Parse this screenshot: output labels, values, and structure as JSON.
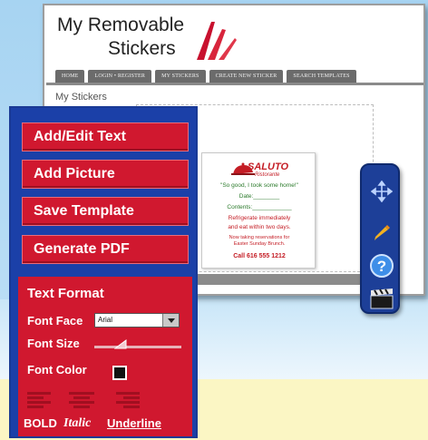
{
  "site": {
    "logo_line1": "My Removable",
    "logo_line2": "Stickers",
    "nav": [
      "HOME",
      "LOGIN • REGISTER",
      "MY STICKERS",
      "CREATE NEW STICKER",
      "SEARCH TEMPLATES"
    ],
    "page_heading": "My Stickers"
  },
  "sticker": {
    "brand": "SALUTO",
    "brand_sub": "Ristorante",
    "quote": "\"So good, I took some home!\"",
    "date_label": "Date:________",
    "contents_label": "Contents:____________",
    "refrigerate_line1": "Refrigerate immediately",
    "refrigerate_line2": "and eat within two days.",
    "reservation_line1": "Now taking reservations for",
    "reservation_line2": "Easter Sunday Brunch.",
    "phone": "Call 616 555 1212"
  },
  "tools": {
    "items": [
      "move-icon",
      "pencil-icon",
      "help-icon",
      "clapperboard-icon"
    ]
  },
  "panel": {
    "add_edit_text": "Add/Edit Text",
    "add_picture": "Add Picture",
    "save_template": "Save Template",
    "generate_pdf": "Generate PDF",
    "text_format_title": "Text Format",
    "font_face_label": "Font Face",
    "font_face_value": "Arial",
    "font_size_label": "Font Size",
    "font_size_level": 0.3,
    "font_color_label": "Font Color",
    "font_color_value": "#111111",
    "bold_label": "BOLD",
    "italic_label": "Italic",
    "underline_label": "Underline"
  },
  "colors": {
    "panel_red": "#d0182f",
    "panel_blue": "#1b40a8",
    "brand_red": "#c41d25",
    "sticker_green": "#2b7a2b"
  }
}
